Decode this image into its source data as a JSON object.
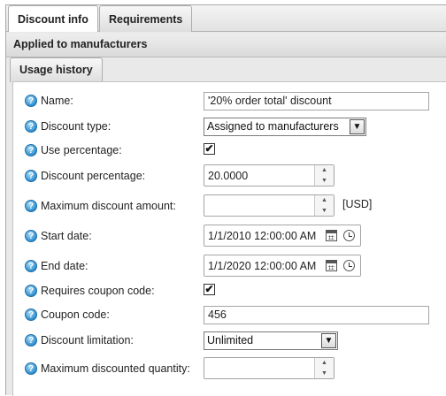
{
  "tabs": {
    "discount_info": "Discount info",
    "requirements": "Requirements",
    "usage_history": "Usage history"
  },
  "section": {
    "applied_to": "Applied to manufacturers"
  },
  "help_glyph": "?",
  "form": {
    "name": {
      "label": "Name:",
      "value": "'20% order total' discount"
    },
    "discount_type": {
      "label": "Discount type:",
      "value": "Assigned to manufacturers"
    },
    "use_percentage": {
      "label": "Use percentage:",
      "checked": true
    },
    "discount_percentage": {
      "label": "Discount percentage:",
      "value": "20.0000"
    },
    "max_discount_amount": {
      "label": "Maximum discount amount:",
      "value": "",
      "unit": "[USD]"
    },
    "start_date": {
      "label": "Start date:",
      "value": "1/1/2010 12:00:00 AM"
    },
    "end_date": {
      "label": "End date:",
      "value": "1/1/2020 12:00:00 AM"
    },
    "requires_coupon": {
      "label": "Requires coupon code:",
      "checked": true
    },
    "coupon_code": {
      "label": "Coupon code:",
      "value": "456"
    },
    "discount_limitation": {
      "label": "Discount limitation:",
      "value": "Unlimited"
    },
    "max_discounted_qty": {
      "label": "Maximum discounted quantity:",
      "value": ""
    }
  },
  "glyphs": {
    "check": "✔",
    "spin_up": "▲",
    "spin_down": "▼",
    "dropdown": "▼"
  },
  "colors": {
    "help_icon": "#2f8fd0",
    "panel_bg": "#e9e9e9"
  }
}
